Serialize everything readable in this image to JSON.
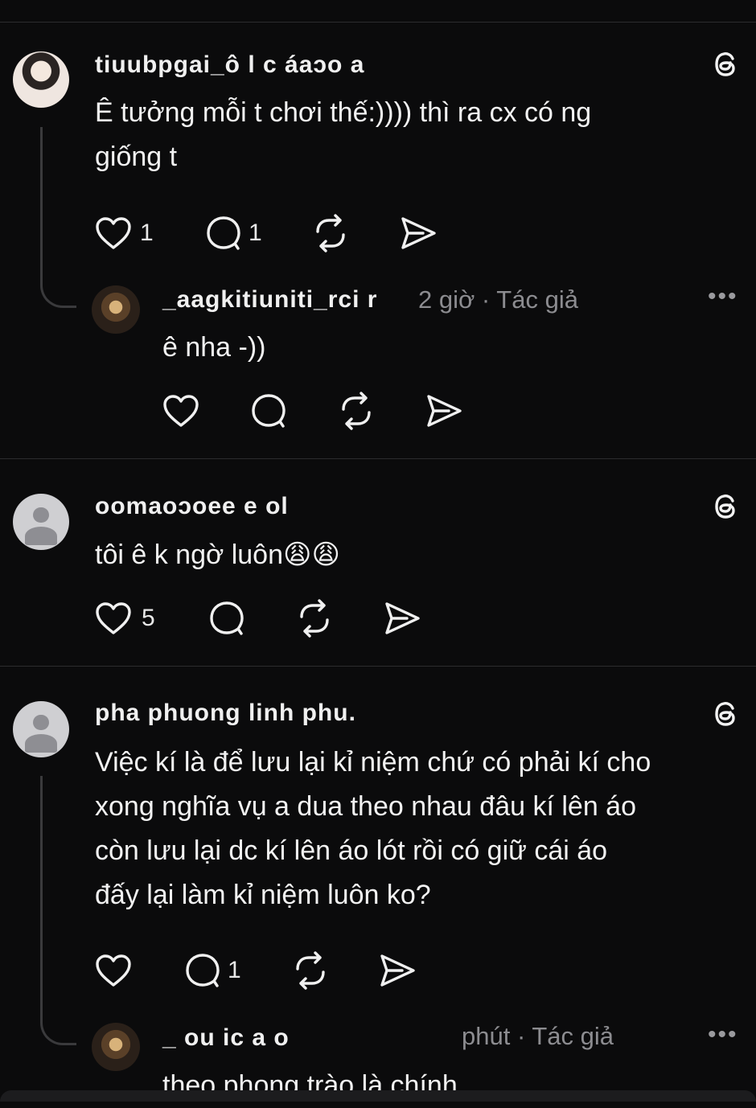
{
  "colors": {
    "background": "#0b0b0c",
    "text": "#f2f2f2",
    "muted": "#8c8c90",
    "divider": "#2c2c2e"
  },
  "comments": [
    {
      "username": "tiuubpgai_ô l c áaɔo a",
      "text": "Ê tưởng mỗi t chơi thế:)))) thì ra cx có ng\ngiống t",
      "likes": "1",
      "replies": "1",
      "reply": {
        "username": "_aagkitiuniti_rci r",
        "meta": "2 giờ · Tác giả",
        "text": "ê nha -))"
      }
    },
    {
      "username": "oomaoɔoee e ol",
      "text": "tôi ê k ngờ luôn😩😩",
      "likes": "5"
    },
    {
      "username": "pha phuong linh phu.",
      "text": "Việc kí là để lưu lại kỉ niệm chứ có phải kí cho\nxong nghĩa vụ a dua theo nhau đâu kí lên áo\ncòn lưu lại dc kí lên áo lót rồi có giữ cái áo\nđấy lại làm kỉ niệm luôn ko?",
      "replies": "1",
      "reply": {
        "username": "_ ou  ic a o",
        "meta": "phút · Tác giả",
        "text": "theo phong trào là chính"
      }
    }
  ],
  "icons": {
    "like": "heart-icon",
    "comment": "comment-bubble-icon",
    "repost": "repost-icon",
    "share": "share-send-icon",
    "brand": "threads-logo-icon",
    "more": "more-options-icon"
  }
}
